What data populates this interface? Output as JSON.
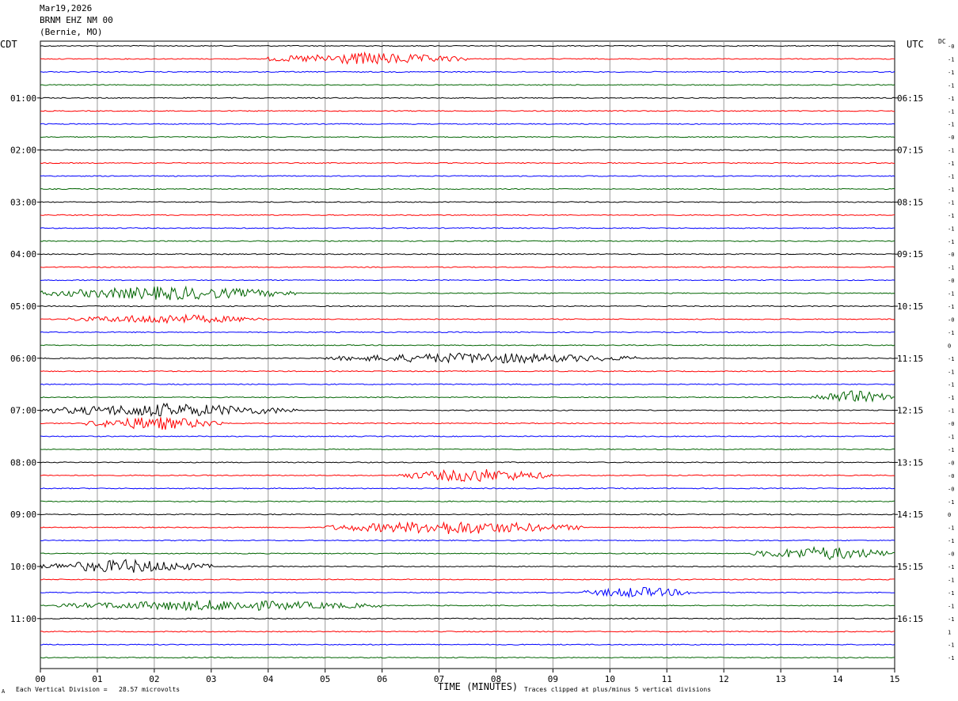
{
  "header": {
    "date": "Mar19,2026",
    "station": "BRNM EHZ NM 00",
    "location": "(Bernie, MO)"
  },
  "left_tz": "CDT",
  "right_tz": "UTC",
  "dc_label": "DC",
  "footer": {
    "left": "Each Vertical Division =   28.57 microvolts",
    "right": "Traces clipped at plus/minus 5 vertical divisions",
    "mark": "A"
  },
  "chart_data": {
    "type": "line",
    "title": "",
    "xlabel": "TIME (MINUTES)",
    "ylabel": "",
    "xlim": [
      0,
      15
    ],
    "x_ticks": [
      "00",
      "01",
      "02",
      "03",
      "04",
      "05",
      "06",
      "07",
      "08",
      "09",
      "10",
      "11",
      "12",
      "13",
      "14",
      "15"
    ],
    "trace_colors": [
      "#000000",
      "#ff0000",
      "#0000ff",
      "#006400"
    ],
    "left_hour_labels": [
      "01:00",
      "02:00",
      "03:00",
      "04:00",
      "05:00",
      "06:00",
      "07:00",
      "08:00",
      "09:00",
      "10:00",
      "11:00"
    ],
    "right_hour_labels": [
      "06:15",
      "07:15",
      "08:15",
      "09:15",
      "10:15",
      "11:15",
      "12:15",
      "13:15",
      "14:15",
      "15:15",
      "16:15"
    ],
    "dc_offsets": [
      "-0",
      "-1",
      "-1",
      "-1",
      "-1",
      "-1",
      "-1",
      "-0",
      "-1",
      "-1",
      "-1",
      "-1",
      "-1",
      "-1",
      "-1",
      "-1",
      "-0",
      "-1",
      "-0",
      "-1",
      "-1",
      "-0",
      "-1",
      "0",
      "-1",
      "-1",
      "-1",
      "-1",
      "-1",
      "-0",
      "-1",
      "-1",
      "-0",
      "-0",
      "-0",
      "-1",
      "0",
      "-1",
      "-1",
      "-0",
      "-1",
      "-1",
      "-1",
      "-1",
      "-1",
      "1",
      "-1",
      "-1"
    ],
    "events": [
      {
        "trace": 1,
        "start": 4.0,
        "end": 7.5,
        "amp": 0.9
      },
      {
        "trace": 19,
        "start": 0.0,
        "end": 4.5,
        "amp": 1.0
      },
      {
        "trace": 21,
        "start": 0.5,
        "end": 4.0,
        "amp": 0.7
      },
      {
        "trace": 24,
        "start": 5.0,
        "end": 10.5,
        "amp": 0.8
      },
      {
        "trace": 27,
        "start": 13.5,
        "end": 15.0,
        "amp": 1.0
      },
      {
        "trace": 28,
        "start": 0.0,
        "end": 4.5,
        "amp": 1.0
      },
      {
        "trace": 29,
        "start": 0.8,
        "end": 3.2,
        "amp": 1.0
      },
      {
        "trace": 33,
        "start": 6.3,
        "end": 9.0,
        "amp": 1.0
      },
      {
        "trace": 37,
        "start": 5.0,
        "end": 9.5,
        "amp": 1.0
      },
      {
        "trace": 39,
        "start": 12.5,
        "end": 15.0,
        "amp": 1.0
      },
      {
        "trace": 40,
        "start": 0.0,
        "end": 3.0,
        "amp": 1.0
      },
      {
        "trace": 43,
        "start": 0.3,
        "end": 6.0,
        "amp": 0.8
      },
      {
        "trace": 42,
        "start": 9.5,
        "end": 11.5,
        "amp": 0.8
      }
    ]
  }
}
